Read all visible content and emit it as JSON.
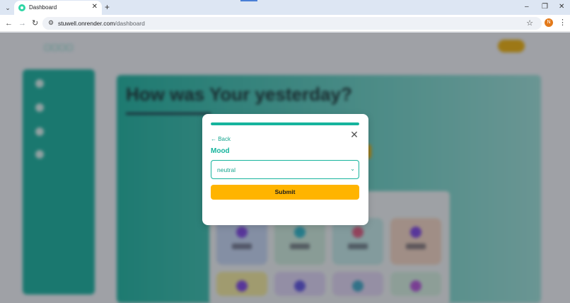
{
  "browser": {
    "tab_title": "Dashboard",
    "url_host": "stuwell.onrender.com",
    "url_path": "/dashboard",
    "profile_initial": "N",
    "icons": [
      "tab-list-icon",
      "tab-close-icon",
      "new-tab-icon",
      "minimize-icon",
      "restore-icon",
      "window-close-icon",
      "back-icon",
      "forward-icon",
      "reload-icon",
      "site-info-icon",
      "star-icon",
      "menu-icon"
    ]
  },
  "background_page": {
    "heading": "How was Your yesterday?"
  },
  "modal": {
    "progress_percent": 100,
    "back_label": "← Back",
    "field_label": "Mood",
    "select_value": "neutral",
    "submit_label": "Submit"
  },
  "colors": {
    "accent": "#16b49d",
    "submit": "#ffb400"
  }
}
